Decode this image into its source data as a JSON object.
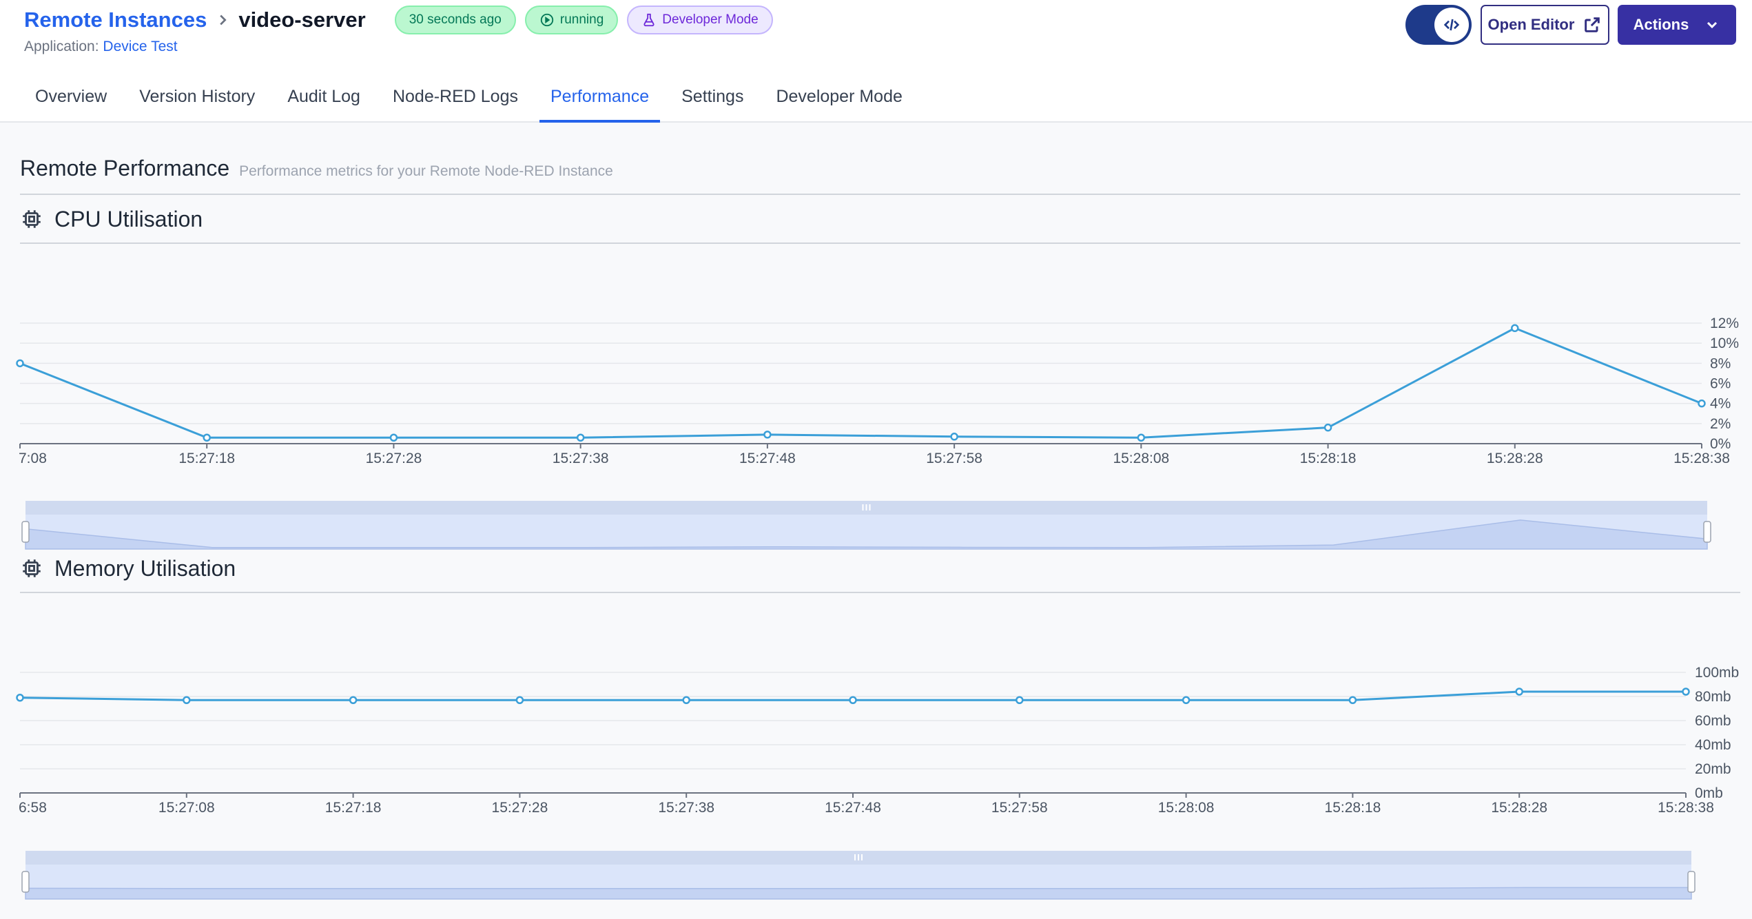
{
  "breadcrumb": {
    "parent": "Remote Instances",
    "current": "video-server"
  },
  "badges": {
    "last_seen": "30 seconds ago",
    "status": "running",
    "mode": "Developer Mode"
  },
  "application": {
    "label": "Application:",
    "name": "Device Test"
  },
  "header_actions": {
    "open_editor": "Open Editor",
    "actions": "Actions"
  },
  "tabs": [
    {
      "label": "Overview",
      "active": false
    },
    {
      "label": "Version History",
      "active": false
    },
    {
      "label": "Audit Log",
      "active": false
    },
    {
      "label": "Node-RED Logs",
      "active": false
    },
    {
      "label": "Performance",
      "active": true
    },
    {
      "label": "Settings",
      "active": false
    },
    {
      "label": "Developer Mode",
      "active": false
    }
  ],
  "section": {
    "title": "Remote Performance",
    "subtitle": "Performance metrics for your Remote Node-RED Instance"
  },
  "icons": {
    "chevron": "chevron-right-icon",
    "running": "play-circle-icon",
    "developer": "beaker-icon",
    "code": "code-icon",
    "external": "external-link-icon",
    "dropdown": "chevron-down-icon",
    "chip": "chip-icon"
  },
  "colors": {
    "link": "#2563eb",
    "series": "#3b9fd8",
    "zoom_fill": "#dbe5fa",
    "button_primary": "#3730a3"
  },
  "chart_data": [
    {
      "type": "line",
      "title": "CPU Utilisation",
      "x": [
        "7:08",
        "15:27:18",
        "15:27:28",
        "15:27:38",
        "15:27:48",
        "15:27:58",
        "15:28:08",
        "15:28:18",
        "15:28:28",
        "15:28:38"
      ],
      "series": [
        {
          "values": [
            8.0,
            0.6,
            0.6,
            0.6,
            0.9,
            0.7,
            0.6,
            1.6,
            11.5,
            4.0
          ]
        }
      ],
      "yticks": [
        "0%",
        "2%",
        "4%",
        "6%",
        "8%",
        "10%",
        "12%"
      ],
      "ylim": [
        0,
        12
      ],
      "y_axis_position": "right",
      "grid": true
    },
    {
      "type": "line",
      "title": "Memory Utilisation",
      "x": [
        "6:58",
        "15:27:08",
        "15:27:18",
        "15:27:28",
        "15:27:38",
        "15:27:48",
        "15:27:58",
        "15:28:08",
        "15:28:18",
        "15:28:28",
        "15:28:38"
      ],
      "series": [
        {
          "values": [
            79,
            77,
            77,
            77,
            77,
            77,
            77,
            77,
            77,
            84,
            84
          ]
        }
      ],
      "yticks": [
        "0mb",
        "20mb",
        "40mb",
        "60mb",
        "80mb",
        "100mb"
      ],
      "ylim": [
        0,
        100
      ],
      "y_axis_position": "right",
      "grid": true
    }
  ]
}
